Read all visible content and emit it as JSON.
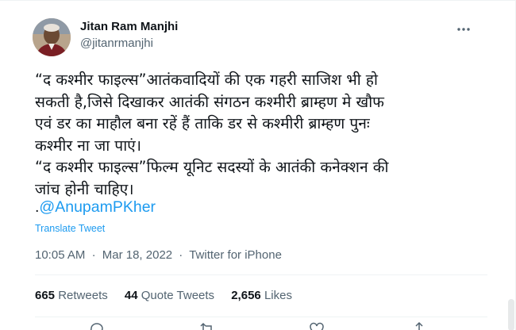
{
  "author": {
    "name": "Jitan Ram Manjhi",
    "handle": "@jitanrmanjhi"
  },
  "tweet": {
    "lines": [
      "“द कश्मीर फाइल्स”आतंकवादियों की एक गहरी साजिश भी हो",
      "सकती है,जिसे दिखाकर आतंकी संगठन कश्मीरी ब्राम्हण मे खौफ",
      "एवं डर का माहौल बना रहें हैं ताकि डर से कश्मीरी ब्राम्हण पुनः",
      "कश्मीर ना जा पाएं।",
      "“द कश्मीर फाइल्स”फिल्म यूनिट सदस्यों के आतंकी कनेक्शन की",
      "जांच होनी चाहिए।"
    ],
    "mention_prefix": ".",
    "mention": "@AnupamPKher",
    "translate_label": "Translate Tweet",
    "time": "10:05 AM",
    "date": "Mar 18, 2022",
    "separator": "·",
    "source": "Twitter for iPhone"
  },
  "stats": {
    "retweets_count": "665",
    "retweets_label": "Retweets",
    "quotes_count": "44",
    "quotes_label": "Quote Tweets",
    "likes_count": "2,656",
    "likes_label": "Likes"
  },
  "icons": {
    "more": "more-horizontal-icon",
    "reply": "reply-icon",
    "retweet": "retweet-icon",
    "like": "like-icon",
    "share": "share-icon"
  },
  "colors": {
    "link": "#1d9bf0",
    "text": "#0f1419",
    "secondary": "#536471",
    "divider": "#eff3f4"
  }
}
